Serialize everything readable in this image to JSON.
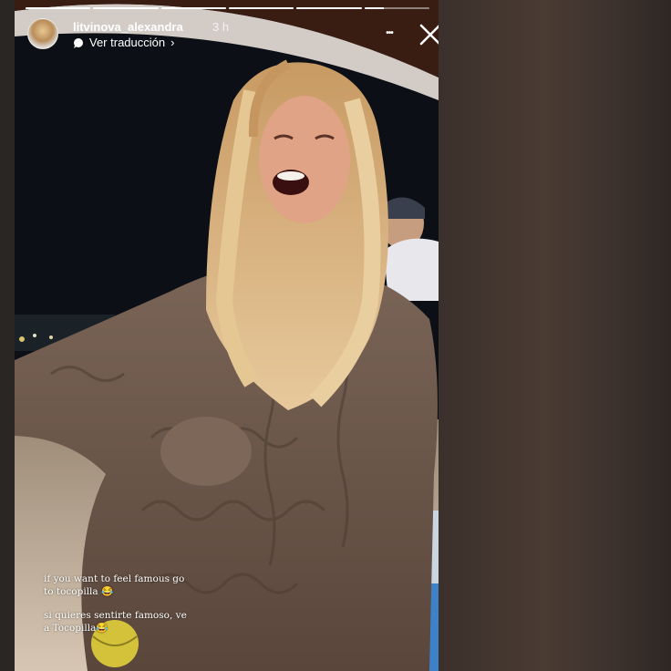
{
  "story": {
    "username": "litvinova_alexandra",
    "timestamp": "3 h",
    "translation_label": "Ver traducción",
    "translation_chevron": "›",
    "more_icon_glyph": "•••",
    "close_icon": "close-icon",
    "progress": {
      "segments": 6,
      "active_index": 5,
      "active_fraction": 0.3
    },
    "captions": {
      "english": "if you want to feel famous go to tocopilla 😂",
      "spanish": "si quieres sentirte famoso, ve a Tocopilla😂"
    }
  },
  "colors": {
    "background": "#2b2522",
    "right_panel": "#4a3b33",
    "sweater": "#6d574a",
    "hair": "#d9b483",
    "ground": "#cdbda9",
    "night_sky": "#0c1016",
    "text": "#ffffff"
  }
}
